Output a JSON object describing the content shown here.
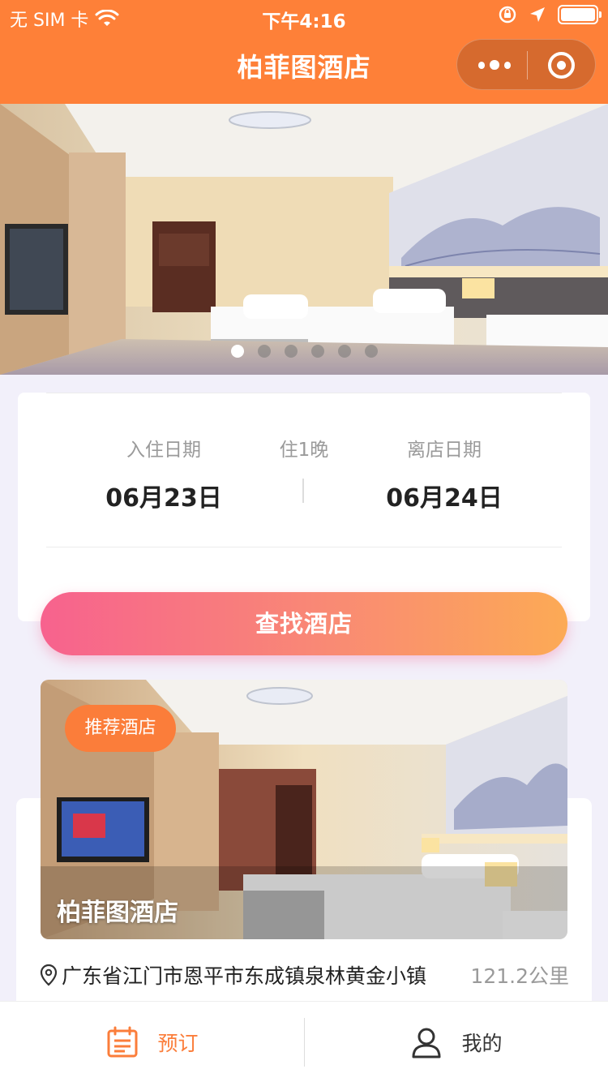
{
  "status_bar": {
    "carrier": "无 SIM 卡",
    "time": "下午4:16"
  },
  "nav": {
    "title": "柏菲图酒店",
    "capsule_more_icon": "more-dots-icon",
    "capsule_close_icon": "target-icon"
  },
  "banner": {
    "slide_count": 6,
    "active_index": 0
  },
  "booking": {
    "checkin_label": "入住日期",
    "checkin_value": "06月23日",
    "nights_label": "住1晚",
    "checkout_label": "离店日期",
    "checkout_value": "06月24日",
    "search_button": "查找酒店"
  },
  "hotel": {
    "tag": "推荐酒店",
    "name": "柏菲图酒店",
    "address": "广东省江门市恩平市东成镇泉林黄金小镇",
    "distance": "121.2公里"
  },
  "tabbar": {
    "items": [
      {
        "label": "预订",
        "icon": "calendar-icon",
        "active": true
      },
      {
        "label": "我的",
        "icon": "user-icon",
        "active": false
      }
    ]
  },
  "colors": {
    "brand": "#fe8038",
    "accent": "#fb7d3a",
    "gradient_start": "#f7628e",
    "gradient_end": "#fcaa55"
  }
}
